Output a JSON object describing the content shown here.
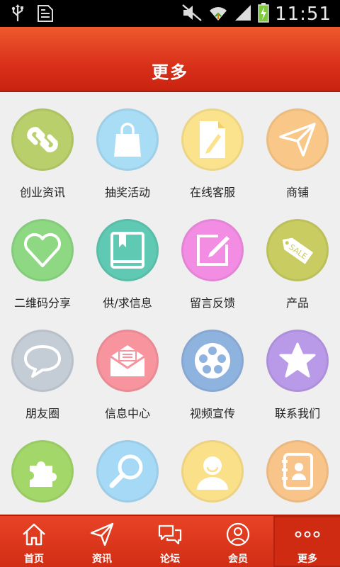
{
  "status_bar": {
    "time": "11:51",
    "left_icons": [
      "usb-icon",
      "sim-icon"
    ],
    "right_icons": [
      "mute-icon",
      "wifi-icon",
      "signal-icon",
      "battery-charging-icon"
    ]
  },
  "header": {
    "title": "更多"
  },
  "grid": {
    "items": [
      {
        "label": "创业资讯",
        "icon": "link-icon",
        "color": "#b9cf6b"
      },
      {
        "label": "抽奖活动",
        "icon": "shopping-bag-icon",
        "color": "#a9dcf5"
      },
      {
        "label": "在线客服",
        "icon": "document-edit-icon",
        "color": "#fbe38d"
      },
      {
        "label": "商铺",
        "icon": "paper-plane-icon",
        "color": "#f9c889"
      },
      {
        "label": "二维码分享",
        "icon": "heart-icon",
        "color": "#8ed884"
      },
      {
        "label": "供/求信息",
        "icon": "book-icon",
        "color": "#5fc9b3"
      },
      {
        "label": "留言反馈",
        "icon": "note-pencil-icon",
        "color": "#f28de3"
      },
      {
        "label": "产品",
        "icon": "sale-tag-icon",
        "color": "#c8cc61"
      },
      {
        "label": "朋友圈",
        "icon": "speech-bubble-icon",
        "color": "#c4ccd6"
      },
      {
        "label": "信息中心",
        "icon": "envelope-icon",
        "color": "#f7949e"
      },
      {
        "label": "视频宣传",
        "icon": "film-reel-icon",
        "color": "#8fb3df"
      },
      {
        "label": "联系我们",
        "icon": "star-icon",
        "color": "#b99ae8"
      },
      {
        "label": "",
        "icon": "puzzle-icon",
        "color": "#a3d76a"
      },
      {
        "label": "",
        "icon": "magnifier-icon",
        "color": "#a6d9f5"
      },
      {
        "label": "",
        "icon": "user-icon",
        "color": "#fbe08a"
      },
      {
        "label": "",
        "icon": "address-book-icon",
        "color": "#f9c48a"
      }
    ]
  },
  "tabbar": {
    "active_index": 4,
    "tabs": [
      {
        "label": "首页",
        "icon": "home-icon"
      },
      {
        "label": "资讯",
        "icon": "paper-plane-icon"
      },
      {
        "label": "论坛",
        "icon": "chat-bubbles-icon"
      },
      {
        "label": "会员",
        "icon": "user-circle-icon"
      },
      {
        "label": "更多",
        "icon": "more-dots-icon"
      }
    ]
  }
}
